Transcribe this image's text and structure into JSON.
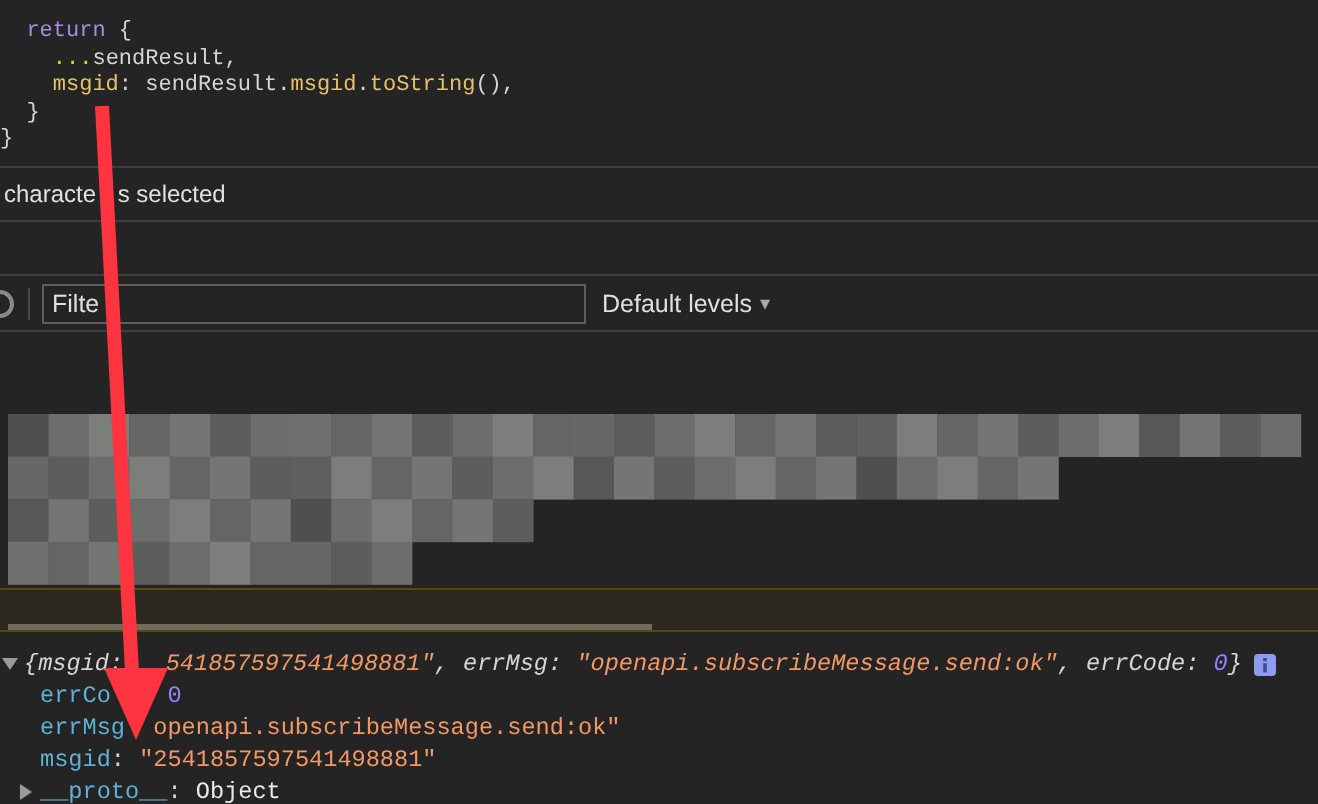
{
  "editor": {
    "lines": [
      [
        {
          "text": "  return",
          "kind": "keyword"
        },
        {
          "text": " {",
          "kind": "plain"
        }
      ],
      [
        {
          "text": "    ...",
          "kind": "spread"
        },
        {
          "text": "sendResult,",
          "kind": "plain"
        }
      ],
      [
        {
          "text": "    msgid",
          "kind": "property"
        },
        {
          "text": ": sendResult.",
          "kind": "plain"
        },
        {
          "text": "msgid",
          "kind": "property"
        },
        {
          "text": ".",
          "kind": "plain"
        },
        {
          "text": "toString",
          "kind": "property"
        },
        {
          "text": "(),",
          "kind": "plain"
        }
      ],
      [
        {
          "text": "  }",
          "kind": "plain"
        }
      ],
      [
        {
          "text": "}",
          "kind": "plain"
        }
      ]
    ]
  },
  "status_bar": {
    "parts": [
      {
        "text": "characte"
      },
      {
        "text": "s selected",
        "occluded": true
      }
    ]
  },
  "toolbar": {
    "filter": {
      "placeholder": "Filte"
    },
    "levels": {
      "label": "Default levels",
      "caret": "▾"
    }
  },
  "console": {
    "summary": {
      "expanded": true,
      "tokens": [
        {
          "text": "{",
          "kind": "punct"
        },
        {
          "text": "msgid",
          "kind": "key"
        },
        {
          "text": ": ",
          "kind": "punct"
        },
        {
          "text": "541857597541498881\"",
          "kind": "string",
          "occluded": true
        },
        {
          "text": ", ",
          "kind": "punct"
        },
        {
          "text": "errMsg",
          "kind": "key"
        },
        {
          "text": ": ",
          "kind": "punct"
        },
        {
          "text": "\"openapi.subscribeMessage.send:ok\"",
          "kind": "string"
        },
        {
          "text": ", ",
          "kind": "punct"
        },
        {
          "text": "errCode",
          "kind": "key"
        },
        {
          "text": ": ",
          "kind": "punct"
        },
        {
          "text": "0",
          "kind": "number"
        },
        {
          "text": "}",
          "kind": "punct"
        }
      ]
    },
    "properties": [
      [
        {
          "text": "errCo",
          "kind": "key"
        },
        {
          "text": "0",
          "kind": "number",
          "occluded": true
        }
      ],
      [
        {
          "text": "errMsg",
          "kind": "key"
        },
        {
          "text": "openapi.subscribeMessage.send:ok\"",
          "kind": "string",
          "occluded": true
        }
      ],
      [
        {
          "text": "msgid",
          "kind": "key"
        },
        {
          "text": ": ",
          "kind": "punct"
        },
        {
          "text": "\"2541857597541498881\"",
          "kind": "string"
        }
      ]
    ],
    "proto": {
      "expanded": false,
      "tokens": [
        {
          "text": "__proto__",
          "kind": "key"
        },
        {
          "text": ": ",
          "kind": "punct"
        },
        {
          "text": "Object",
          "kind": "plain"
        }
      ]
    }
  }
}
